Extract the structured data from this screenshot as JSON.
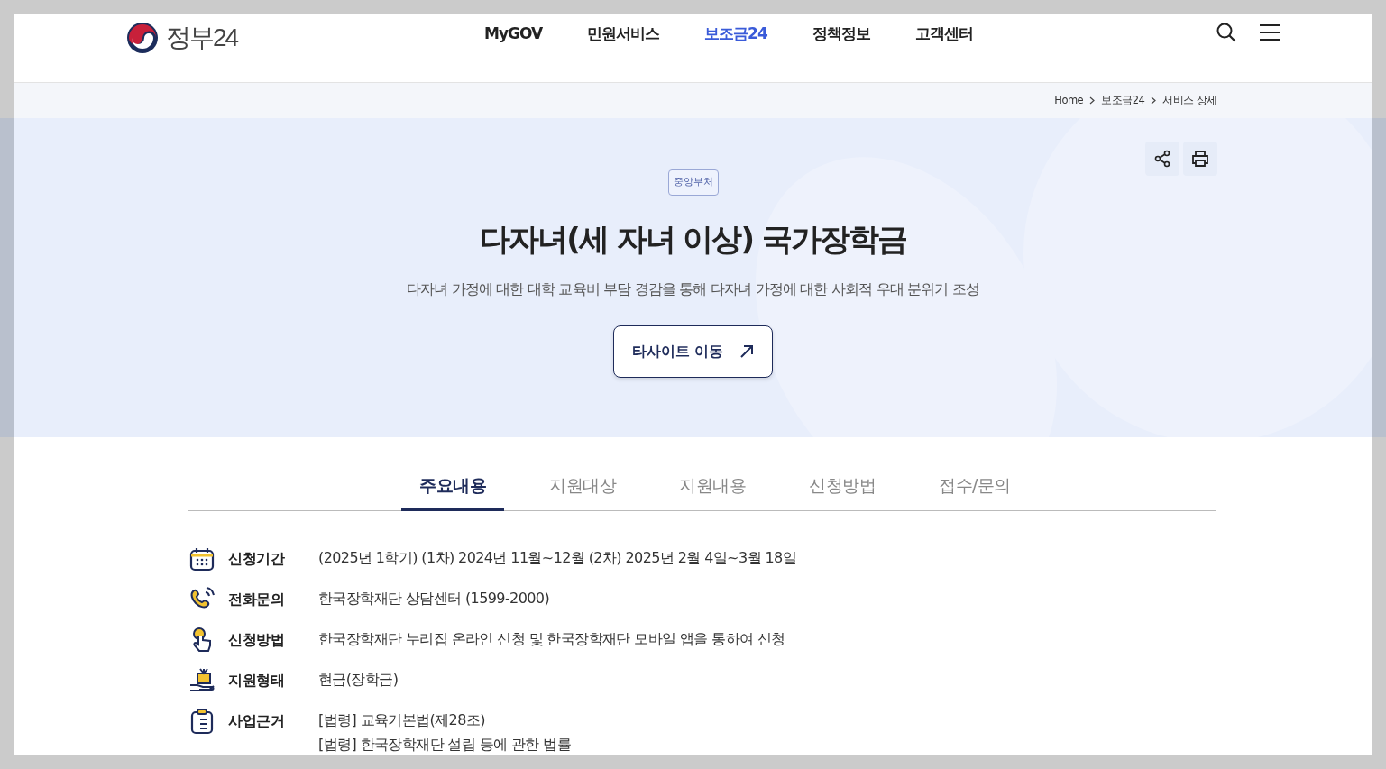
{
  "header": {
    "logo": "정부24",
    "nav": [
      {
        "label": "MyGOV",
        "selected": false
      },
      {
        "label": "민원서비스",
        "selected": false
      },
      {
        "label": "보조금24",
        "selected": true
      },
      {
        "label": "정책정보",
        "selected": false
      },
      {
        "label": "고객센터",
        "selected": false
      }
    ]
  },
  "breadcrumb": [
    "Home",
    "보조금24",
    "서비스 상세"
  ],
  "hero": {
    "badge": "중앙부처",
    "title": "다자녀(세 자녀 이상) 국가장학금",
    "description": "다자녀 가정에 대한 대학 교육비 부담 경감을 통해 다자녀 가정에 대한 사회적 우대 분위기 조성",
    "button": "타사이트 이동"
  },
  "tabs": [
    {
      "label": "주요내용",
      "selected": true
    },
    {
      "label": "지원대상",
      "selected": false
    },
    {
      "label": "지원내용",
      "selected": false
    },
    {
      "label": "신청방법",
      "selected": false
    },
    {
      "label": "접수/문의",
      "selected": false
    }
  ],
  "details": [
    {
      "kind": "calendar",
      "label": "신청기간",
      "values": [
        "(2025년 1학기) (1차) 2024년 11월~12월 (2차) 2025년 2월 4일~3월 18일"
      ]
    },
    {
      "kind": "phone",
      "label": "전화문의",
      "values": [
        "한국장학재단 상담센터 (1599-2000)"
      ]
    },
    {
      "kind": "hand",
      "label": "신청방법",
      "values": [
        "한국장학재단 누리집 온라인 신청 및 한국장학재단 모바일 앱을 통하여 신청"
      ]
    },
    {
      "kind": "gift",
      "label": "지원형태",
      "values": [
        "현금(장학금)"
      ]
    },
    {
      "kind": "clipboard",
      "label": "사업근거",
      "values": [
        "[법령] 교육기본법(제28조)",
        "[법령] 한국장학재단 설립 등에 관한 법률"
      ]
    }
  ]
}
